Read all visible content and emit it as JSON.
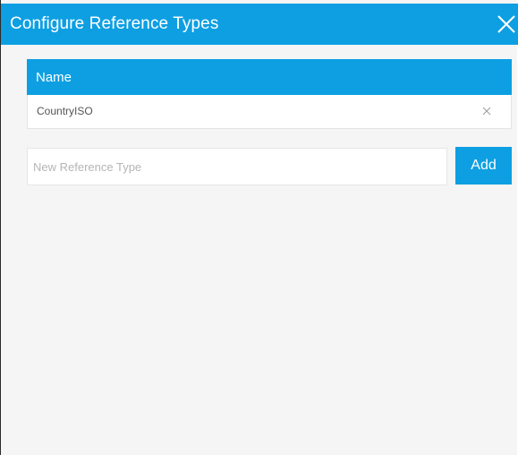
{
  "dialog": {
    "title": "Configure Reference Types",
    "close_icon": "close-icon"
  },
  "table": {
    "header": "Name",
    "rows": [
      {
        "name": "CountryISO",
        "remove_icon": "close-icon"
      }
    ]
  },
  "new_type": {
    "value": "",
    "placeholder": "New Reference Type",
    "add_label": "Add"
  },
  "colors": {
    "accent": "#0d9fe2",
    "background": "#f5f5f5"
  }
}
